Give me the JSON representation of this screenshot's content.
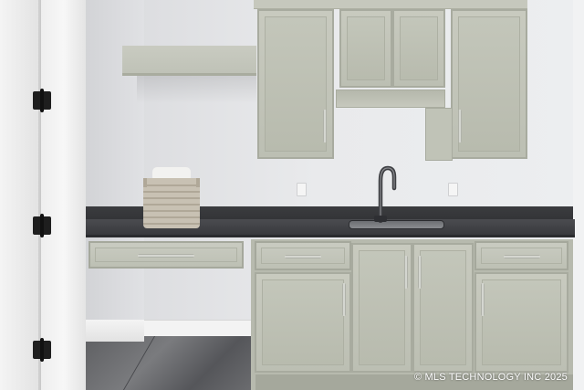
{
  "photo": {
    "watermark": "© MLS TECHNOLOGY INC 2025"
  },
  "icons": {
    "door_hinge": "door-hinge-icon",
    "cabinet_handle": "cabinet-handle-icon",
    "faucet": "faucet-icon",
    "outlet": "outlet-icon",
    "basket": "wicker-basket-icon"
  },
  "colors": {
    "cabinet": "#bfc2b6",
    "countertop": "#3f4044",
    "wall": "#e6e7e9",
    "floor": "#65666a"
  }
}
